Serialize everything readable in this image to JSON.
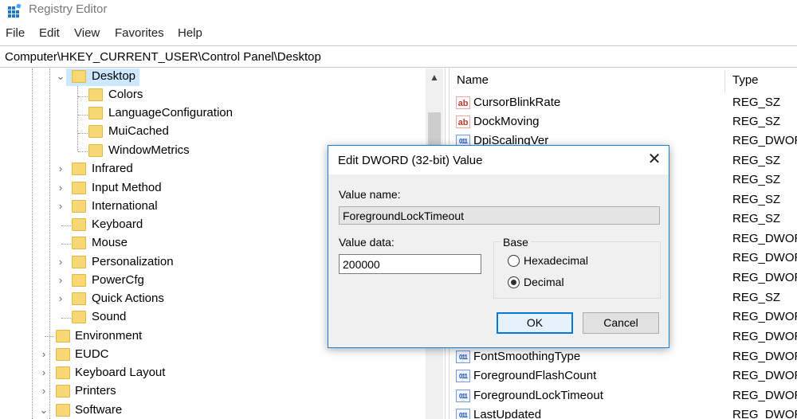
{
  "window": {
    "title": "Registry Editor"
  },
  "menu": [
    "File",
    "Edit",
    "View",
    "Favorites",
    "Help"
  ],
  "address": "Computer\\HKEY_CURRENT_USER\\Control Panel\\Desktop",
  "tree": {
    "items": [
      {
        "label": "Desktop",
        "expander": "expanded",
        "selected": true
      },
      {
        "label": "Colors",
        "expander": "none"
      },
      {
        "label": "LanguageConfiguration",
        "expander": "none"
      },
      {
        "label": "MuiCached",
        "expander": "none"
      },
      {
        "label": "WindowMetrics",
        "expander": "none"
      },
      {
        "label": "Infrared",
        "expander": "collapsed"
      },
      {
        "label": "Input Method",
        "expander": "collapsed"
      },
      {
        "label": "International",
        "expander": "collapsed"
      },
      {
        "label": "Keyboard",
        "expander": "none"
      },
      {
        "label": "Mouse",
        "expander": "none"
      },
      {
        "label": "Personalization",
        "expander": "collapsed"
      },
      {
        "label": "PowerCfg",
        "expander": "collapsed"
      },
      {
        "label": "Quick Actions",
        "expander": "collapsed"
      },
      {
        "label": "Sound",
        "expander": "none"
      },
      {
        "label": "Environment",
        "expander": "none"
      },
      {
        "label": "EUDC",
        "expander": "collapsed"
      },
      {
        "label": "Keyboard Layout",
        "expander": "collapsed"
      },
      {
        "label": "Printers",
        "expander": "collapsed"
      },
      {
        "label": "Software",
        "expander": "expanded"
      }
    ]
  },
  "list": {
    "columns": {
      "name": "Name",
      "type": "Type"
    },
    "rows": [
      {
        "name": "CursorBlinkRate",
        "type": "REG_SZ",
        "icon": "string-value-icon"
      },
      {
        "name": "DockMoving",
        "type": "REG_SZ",
        "icon": "string-value-icon"
      },
      {
        "name": "DpiScalingVer",
        "type": "REG_DWOR",
        "icon": "binary-value-icon"
      },
      {
        "name": "",
        "type": "REG_SZ",
        "icon": ""
      },
      {
        "name": "",
        "type": "REG_SZ",
        "icon": ""
      },
      {
        "name": "",
        "type": "REG_SZ",
        "icon": ""
      },
      {
        "name": "",
        "type": "REG_SZ",
        "icon": ""
      },
      {
        "name": "",
        "type": "REG_DWOR",
        "icon": ""
      },
      {
        "name": "",
        "type": "REG_DWOR",
        "icon": ""
      },
      {
        "name": "",
        "type": "REG_DWOR",
        "icon": ""
      },
      {
        "name": "",
        "type": "REG_SZ",
        "icon": ""
      },
      {
        "name": "",
        "type": "REG_DWOR",
        "icon": ""
      },
      {
        "name": "",
        "type": "REG_DWOR",
        "icon": ""
      },
      {
        "name": "FontSmoothingType",
        "type": "REG_DWOR",
        "icon": "binary-value-icon"
      },
      {
        "name": "ForegroundFlashCount",
        "type": "REG_DWOR",
        "icon": "binary-value-icon"
      },
      {
        "name": "ForegroundLockTimeout",
        "type": "REG_DWOR",
        "icon": "binary-value-icon"
      },
      {
        "name": "LastUpdated",
        "type": "REG_DWOR",
        "icon": "binary-value-icon"
      }
    ]
  },
  "dialog": {
    "title": "Edit DWORD (32-bit) Value",
    "value_name_label": "Value name:",
    "value_name": "ForegroundLockTimeout",
    "value_data_label": "Value data:",
    "value_data": "200000",
    "base_label": "Base",
    "hex_label": "Hexadecimal",
    "decimal_label": "Decimal",
    "base_selected": "Decimal",
    "ok_label": "OK",
    "cancel_label": "Cancel"
  },
  "colors": {
    "accent": "#0078d7",
    "selection": "#cce8ff",
    "folder": "#f8d775"
  },
  "icons": {
    "app": "registry-editor-icon",
    "close": "close-icon",
    "expanded": "chevron-down-icon",
    "collapsed": "chevron-right-icon"
  }
}
